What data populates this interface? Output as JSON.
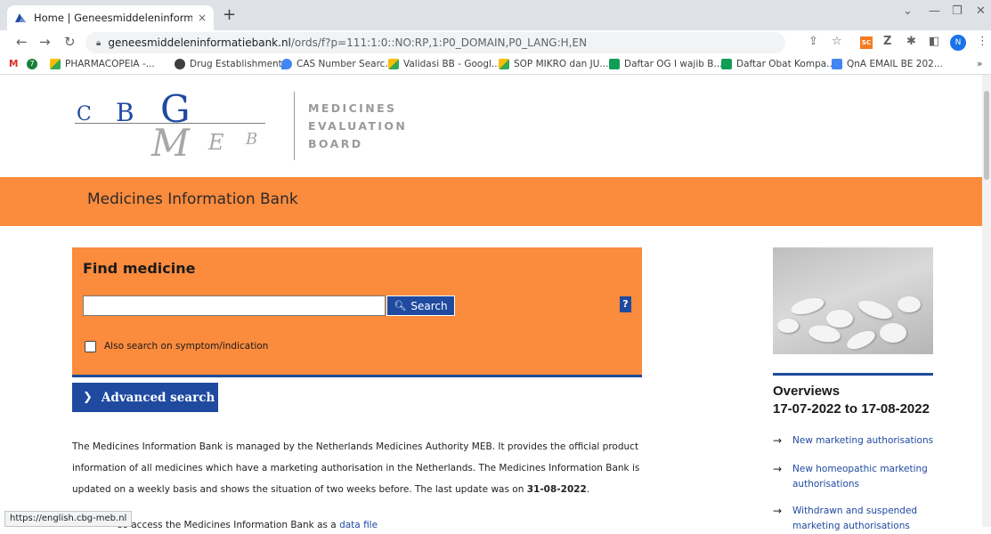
{
  "browser": {
    "tab_title": "Home | Geneesmiddeleninformat",
    "tab_close": "×",
    "new_tab": "+",
    "url_host": "geneesmiddeleninformatiebank.nl",
    "url_path": "/ords/f?p=111:1:0::NO:RP,1:P0_DOMAIN,P0_LANG:H,EN",
    "profile_initial": "N",
    "ext_label": "SC",
    "bookmarks": [
      {
        "label": "",
        "color": "#d93025",
        "glyph": "M"
      },
      {
        "label": "",
        "color": "#188038",
        "glyph": "7"
      },
      {
        "label": "PHARMACOPEIA -...",
        "color": "#fbbc04"
      },
      {
        "label": "Drug Establishment...",
        "color": "#3c4043"
      },
      {
        "label": "CAS Number Searc...",
        "color": "#4285f4"
      },
      {
        "label": "Validasi BB - Googl...",
        "color": "#fbbc04"
      },
      {
        "label": "SOP MIKRO dan JU...",
        "color": "#fbbc04"
      },
      {
        "label": "Daftar OG I wajib B...",
        "color": "#0f9d58"
      },
      {
        "label": "Daftar Obat Kompa...",
        "color": "#0f9d58"
      },
      {
        "label": "QnA EMAIL BE 202...",
        "color": "#4285f4"
      }
    ],
    "bookmarks_more": "»",
    "status_url": "https://english.cbg-meb.nl"
  },
  "logo": {
    "c": "C",
    "b": "B",
    "g": "G",
    "m": "M",
    "e": "E",
    "b2": "B",
    "line1": "MEDICINES",
    "line2": "EVALUATION",
    "line3": "BOARD"
  },
  "banner": {
    "title": "Medicines Information Bank"
  },
  "find": {
    "title": "Find medicine",
    "search_value": "",
    "search_button": "Search",
    "help": "?",
    "checkbox_label": "Also search on symptom/indication"
  },
  "advanced": {
    "label": "Advanced search"
  },
  "intro": {
    "text_main": "The Medicines Information Bank is managed by the Netherlands Medicines Authority MEB. It provides the official product information of all medicines which have a marketing authorisation in the Netherlands. The Medicines Information Bank is updated on a weekly basis and shows the situation of two weeks before. The last update was on ",
    "last_update": "31-08-2022",
    "period": ".",
    "text2_prefix": "so access the Medicines Information Bank as a ",
    "text2_link": "data file"
  },
  "overviews": {
    "title": "Overviews",
    "range": "17-07-2022 to 17-08-2022",
    "items": [
      {
        "line1": "New marketing authorisations",
        "line2": ""
      },
      {
        "line1": "New homeopathic marketing",
        "line2": "authorisations"
      },
      {
        "line1": "Withdrawn and suspended",
        "line2": "marketing authorisations"
      }
    ]
  }
}
